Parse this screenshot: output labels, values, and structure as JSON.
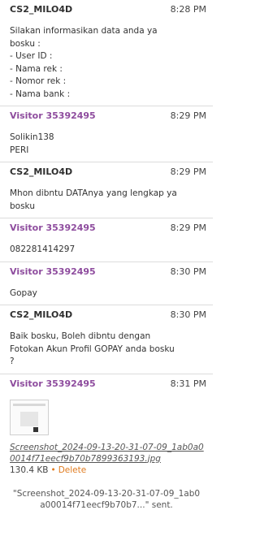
{
  "messages": [
    {
      "sender": "CS2_MILO4D",
      "role": "agent",
      "time": "8:28 PM",
      "text": "Silakan informasikan data anda ya\nbosku :\n- User ID :\n- Nama rek :\n- Nomor rek :\n- Nama bank :"
    },
    {
      "sender": "Visitor 35392495",
      "role": "visitor",
      "time": "8:29 PM",
      "text": "Solikin138\nPERI"
    },
    {
      "sender": "CS2_MILO4D",
      "role": "agent",
      "time": "8:29 PM",
      "text": "Mhon dibntu DATAnya yang lengkap ya\nbosku"
    },
    {
      "sender": "Visitor 35392495",
      "role": "visitor",
      "time": "8:29 PM",
      "text": "082281414297"
    },
    {
      "sender": "Visitor 35392495",
      "role": "visitor",
      "time": "8:30 PM",
      "text": "Gopay"
    },
    {
      "sender": "CS2_MILO4D",
      "role": "agent",
      "time": "8:30 PM",
      "text": "Baik bosku, Boleh dibntu dengan\nFotokan Akun Profil GOPAY anda bosku\n?"
    },
    {
      "sender": "Visitor 35392495",
      "role": "visitor",
      "time": "8:31 PM",
      "attachment": {
        "filename": "Screenshot_2024-09-13-20-31-07-09_1ab0a00014f71eecf9b70b7899363193.jpg",
        "size": "130.4 KB",
        "separator": "•",
        "delete_label": "Delete"
      }
    }
  ],
  "sent_note": "\"Screenshot_2024-09-13-20-31-07-09_1ab0a00014f71eecf9b70b7...\" sent."
}
